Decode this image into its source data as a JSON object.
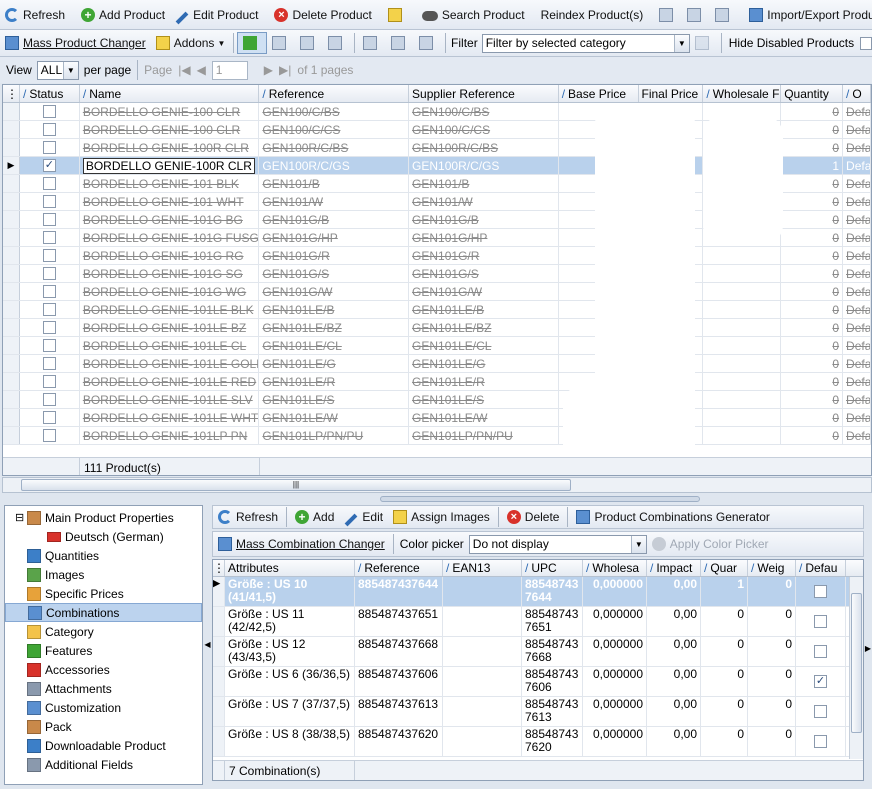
{
  "toolbar1": {
    "refresh": "Refresh",
    "add_product": "Add Product",
    "edit_product": "Edit Product",
    "delete_product": "Delete Product",
    "search_product": "Search Product",
    "reindex": "Reindex Product(s)",
    "import_export": "Import/Export Products"
  },
  "toolbar2": {
    "mass_changer": "Mass Product Changer",
    "addons": "Addons",
    "filter_label": "Filter",
    "filter_value": "Filter by selected category",
    "hide_disabled": "Hide Disabled Products"
  },
  "paging": {
    "view_label": "View",
    "view_value": "ALL",
    "per_page": "per page",
    "page_label": "Page",
    "page_value": "1",
    "of_pages": "of 1 pages"
  },
  "grid": {
    "columns": [
      "Status",
      "Name",
      "Reference",
      "Supplier Reference",
      "Base Price",
      "Final Price",
      "Wholesale F",
      "Quantity",
      "O"
    ],
    "rows": [
      {
        "name": "BORDELLO GENIE-100 CLR",
        "ref": "GEN100/C/BS",
        "sup": "GEN100/C/BS",
        "qty": "0",
        "def": "Defau",
        "checked": false,
        "disabled": true,
        "selected": false
      },
      {
        "name": "BORDELLO GENIE-100 CLR",
        "ref": "GEN100/C/CS",
        "sup": "GEN100/C/CS",
        "qty": "0",
        "def": "Defau",
        "checked": false,
        "disabled": true,
        "selected": false
      },
      {
        "name": "BORDELLO GENIE-100R CLR",
        "ref": "GEN100R/C/BS",
        "sup": "GEN100R/C/BS",
        "qty": "0",
        "def": "Defau",
        "checked": false,
        "disabled": true,
        "selected": false
      },
      {
        "name": "BORDELLO GENIE-100R CLR",
        "ref": "GEN100R/C/GS",
        "sup": "GEN100R/C/GS",
        "qty": "1",
        "def": "Defau",
        "checked": true,
        "disabled": false,
        "selected": true
      },
      {
        "name": "BORDELLO GENIE-101 BLK",
        "ref": "GEN101/B",
        "sup": "GEN101/B",
        "qty": "0",
        "def": "Defau",
        "checked": false,
        "disabled": true,
        "selected": false
      },
      {
        "name": "BORDELLO GENIE-101 WHT",
        "ref": "GEN101/W",
        "sup": "GEN101/W",
        "qty": "0",
        "def": "Defau",
        "checked": false,
        "disabled": true,
        "selected": false
      },
      {
        "name": "BORDELLO GENIE-101G BG",
        "ref": "GEN101G/B",
        "sup": "GEN101G/B",
        "qty": "0",
        "def": "Defau",
        "checked": false,
        "disabled": true,
        "selected": false
      },
      {
        "name": "BORDELLO GENIE-101G FUSG",
        "ref": "GEN101G/HP",
        "sup": "GEN101G/HP",
        "qty": "0",
        "def": "Defau",
        "checked": false,
        "disabled": true,
        "selected": false
      },
      {
        "name": "BORDELLO GENIE-101G RG",
        "ref": "GEN101G/R",
        "sup": "GEN101G/R",
        "qty": "0",
        "def": "Defau",
        "checked": false,
        "disabled": true,
        "selected": false
      },
      {
        "name": "BORDELLO GENIE-101G SG",
        "ref": "GEN101G/S",
        "sup": "GEN101G/S",
        "qty": "0",
        "def": "Defau",
        "checked": false,
        "disabled": true,
        "selected": false
      },
      {
        "name": "BORDELLO GENIE-101G WG",
        "ref": "GEN101G/W",
        "sup": "GEN101G/W",
        "qty": "0",
        "def": "Defau",
        "checked": false,
        "disabled": true,
        "selected": false
      },
      {
        "name": "BORDELLO GENIE-101LE BLK",
        "ref": "GEN101LE/B",
        "sup": "GEN101LE/B",
        "qty": "0",
        "def": "Defau",
        "checked": false,
        "disabled": true,
        "selected": false
      },
      {
        "name": "BORDELLO GENIE-101LE BZ",
        "ref": "GEN101LE/BZ",
        "sup": "GEN101LE/BZ",
        "qty": "0",
        "def": "Defau",
        "checked": false,
        "disabled": true,
        "selected": false
      },
      {
        "name": "BORDELLO GENIE-101LE CL",
        "ref": "GEN101LE/CL",
        "sup": "GEN101LE/CL",
        "qty": "0",
        "def": "Defau",
        "checked": false,
        "disabled": true,
        "selected": false
      },
      {
        "name": "BORDELLO GENIE-101LE GOLD",
        "ref": "GEN101LE/G",
        "sup": "GEN101LE/G",
        "qty": "0",
        "def": "Defau",
        "checked": false,
        "disabled": true,
        "selected": false
      },
      {
        "name": "BORDELLO GENIE-101LE RED",
        "ref": "GEN101LE/R",
        "sup": "GEN101LE/R",
        "qty": "0",
        "def": "Defau",
        "checked": false,
        "disabled": true,
        "selected": false
      },
      {
        "name": "BORDELLO GENIE-101LE SLV",
        "ref": "GEN101LE/S",
        "sup": "GEN101LE/S",
        "qty": "0",
        "def": "Defau",
        "checked": false,
        "disabled": true,
        "selected": false
      },
      {
        "name": "BORDELLO GENIE-101LE WHT",
        "ref": "GEN101LE/W",
        "sup": "GEN101LE/W",
        "qty": "0",
        "def": "Defau",
        "checked": false,
        "disabled": true,
        "selected": false
      },
      {
        "name": "BORDELLO GENIE-101LP PN",
        "ref": "GEN101LP/PN/PU",
        "sup": "GEN101LP/PN/PU",
        "qty": "0",
        "def": "Defau",
        "checked": false,
        "disabled": true,
        "selected": false
      }
    ],
    "footer": "111 Product(s)"
  },
  "nav": {
    "items": [
      {
        "label": "Main Product Properties",
        "icon": "box-icon"
      },
      {
        "label": "Deutsch (German)",
        "icon": "flag-icon"
      },
      {
        "label": "Quantities",
        "icon": "numbers-icon"
      },
      {
        "label": "Images",
        "icon": "image-icon"
      },
      {
        "label": "Specific Prices",
        "icon": "price-icon"
      },
      {
        "label": "Combinations",
        "icon": "combinations-icon"
      },
      {
        "label": "Category",
        "icon": "folder-icon"
      },
      {
        "label": "Features",
        "icon": "features-icon"
      },
      {
        "label": "Accessories",
        "icon": "accessories-icon"
      },
      {
        "label": "Attachments",
        "icon": "attachment-icon"
      },
      {
        "label": "Customization",
        "icon": "customization-icon"
      },
      {
        "label": "Pack",
        "icon": "pack-icon"
      },
      {
        "label": "Downloadable Product",
        "icon": "download-icon"
      },
      {
        "label": "Additional Fields",
        "icon": "fields-icon"
      }
    ]
  },
  "comb_toolbar": {
    "refresh": "Refresh",
    "add": "Add",
    "edit": "Edit",
    "assign_images": "Assign Images",
    "delete": "Delete",
    "generator": "Product Combinations Generator"
  },
  "comb_toolbar2": {
    "mass_changer": "Mass Combination Changer",
    "color_picker_label": "Color picker",
    "color_picker_value": "Do not display",
    "apply_color": "Apply Color Picker"
  },
  "comb_grid": {
    "columns": [
      "Attributes",
      "Reference",
      "EAN13",
      "UPC",
      "Wholesa",
      "Impact",
      "Quar",
      "Weig",
      "Defau"
    ],
    "rows": [
      {
        "attr": "Größe : US 10 (41/41,5)",
        "ref": "885487437644",
        "ean": "",
        "upc": "885487437644",
        "wholesale": "0,000000",
        "impact": "0,00",
        "qty": "1",
        "weight": "0",
        "default": false,
        "selected": true
      },
      {
        "attr": "Größe : US 11 (42/42,5)",
        "ref": "885487437651",
        "ean": "",
        "upc": "885487437651",
        "wholesale": "0,000000",
        "impact": "0,00",
        "qty": "0",
        "weight": "0",
        "default": false,
        "selected": false
      },
      {
        "attr": "Größe : US 12 (43/43,5)",
        "ref": "885487437668",
        "ean": "",
        "upc": "885487437668",
        "wholesale": "0,000000",
        "impact": "0,00",
        "qty": "0",
        "weight": "0",
        "default": false,
        "selected": false
      },
      {
        "attr": "Größe : US 6 (36/36,5)",
        "ref": "885487437606",
        "ean": "",
        "upc": "885487437606",
        "wholesale": "0,000000",
        "impact": "0,00",
        "qty": "0",
        "weight": "0",
        "default": true,
        "selected": false
      },
      {
        "attr": "Größe : US 7 (37/37,5)",
        "ref": "885487437613",
        "ean": "",
        "upc": "885487437613",
        "wholesale": "0,000000",
        "impact": "0,00",
        "qty": "0",
        "weight": "0",
        "default": false,
        "selected": false
      },
      {
        "attr": "Größe : US 8 (38/38,5)",
        "ref": "885487437620",
        "ean": "",
        "upc": "885487437620",
        "wholesale": "0,000000",
        "impact": "0,00",
        "qty": "0",
        "weight": "0",
        "default": false,
        "selected": false
      }
    ],
    "footer": "7 Combination(s)"
  }
}
